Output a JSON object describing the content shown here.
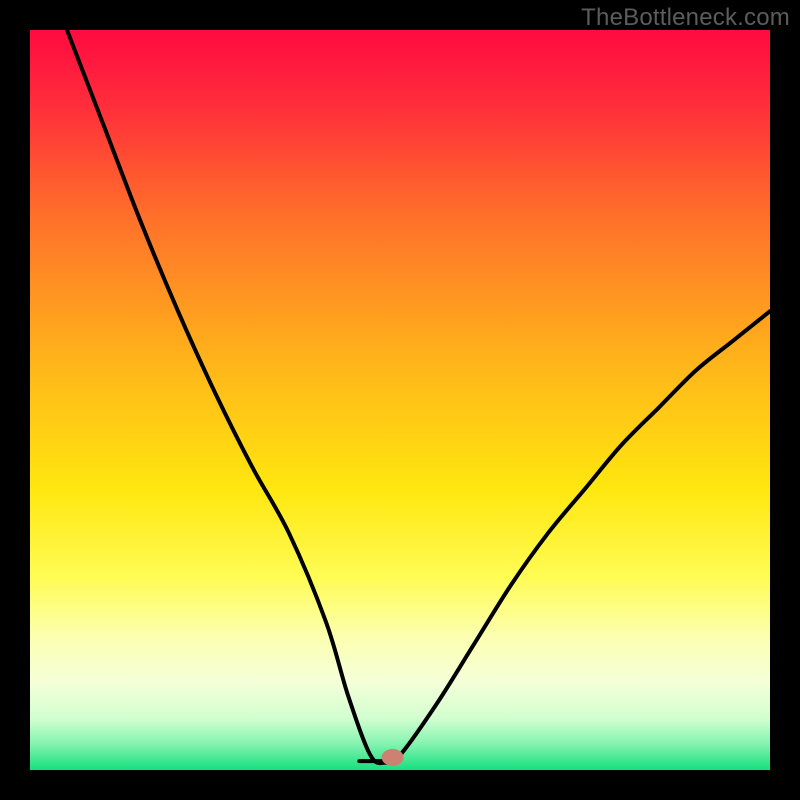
{
  "watermark": "TheBottleneck.com",
  "chart_data": {
    "type": "line",
    "title": "",
    "xlabel": "",
    "ylabel": "",
    "xlim": [
      0,
      100
    ],
    "ylim": [
      0,
      100
    ],
    "series": [
      {
        "name": "bottleneck-curve",
        "x": [
          5,
          10,
          15,
          20,
          25,
          30,
          35,
          40,
          43,
          46,
          48,
          50,
          55,
          60,
          65,
          70,
          75,
          80,
          85,
          90,
          95,
          100
        ],
        "y": [
          100,
          87,
          74,
          62,
          51,
          41,
          32,
          20,
          10,
          2,
          1,
          2,
          9,
          17,
          25,
          32,
          38,
          44,
          49,
          54,
          58,
          62
        ]
      }
    ],
    "marker": {
      "x": 49,
      "y": 1.7
    },
    "plateau": {
      "x_start": 44.5,
      "x_end": 49,
      "y": 1.2
    },
    "gradient_stops": [
      {
        "offset": 0.0,
        "color": "#ff0b40"
      },
      {
        "offset": 0.1,
        "color": "#ff2d3b"
      },
      {
        "offset": 0.25,
        "color": "#ff6f2a"
      },
      {
        "offset": 0.45,
        "color": "#ffb51a"
      },
      {
        "offset": 0.62,
        "color": "#ffe70f"
      },
      {
        "offset": 0.74,
        "color": "#fffc55"
      },
      {
        "offset": 0.82,
        "color": "#fcffb0"
      },
      {
        "offset": 0.88,
        "color": "#f5ffd8"
      },
      {
        "offset": 0.93,
        "color": "#d2ffcf"
      },
      {
        "offset": 0.965,
        "color": "#84f3b0"
      },
      {
        "offset": 1.0,
        "color": "#15e07e"
      }
    ],
    "frame": {
      "outer": 800,
      "inset": 30
    }
  }
}
